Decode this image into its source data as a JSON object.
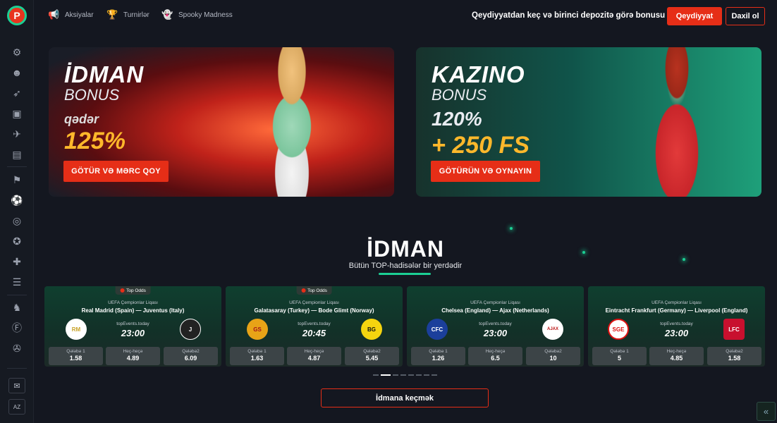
{
  "logo": "P",
  "sidebar": {
    "icons": [
      "gear-icon",
      "live-person-icon",
      "rocket-icon",
      "tv-icon",
      "aviator-icon",
      "casino-icon",
      "sports-icon",
      "football-icon",
      "roulette-icon",
      "wheel-icon",
      "gamepad-icon",
      "news-icon",
      "horse-icon",
      "fantasy-icon",
      "support-icon"
    ],
    "chat_label": "chat",
    "language_label": "AZ"
  },
  "topnav": {
    "items": [
      {
        "label": "Aksiyalar",
        "icon": "megaphone-icon"
      },
      {
        "label": "Turnirlər",
        "icon": "trophy-icon"
      },
      {
        "label": "Spooky Madness",
        "icon": "ghost-icon"
      }
    ],
    "promo": "Qeydiyyatdan keç və birinci depozitə görə bonusu götür",
    "register": "Qeydiyyat",
    "login": "Daxil ol"
  },
  "banners": [
    {
      "title": "İDMAN",
      "subtitle": "BONUS",
      "small": "qədər",
      "big": "125%",
      "button": "GÖTÜR VƏ MƏRC QOY"
    },
    {
      "title": "KAZINO",
      "subtitle": "BONUS",
      "mid": "120%",
      "big": "+ 250 FS",
      "button": "GÖTÜRÜN VƏ OYNAYIN"
    }
  ],
  "section": {
    "title": "İDMAN",
    "subtitle": "Bütün TOP-hadisələr bir yerdədir",
    "cta": "İdmana keçmək"
  },
  "events": [
    {
      "badge": "Top Odds",
      "league": "UEFA Çempionlar Liqası",
      "teams": "Real Madrid (Spain)  —  Juventus (Italy)",
      "site": "topEvents.today",
      "time": "23:00",
      "home": "RM",
      "away": "J",
      "odds": [
        {
          "label": "Qələbə 1",
          "value": "1.58"
        },
        {
          "label": "Heç-heçə",
          "value": "4.89"
        },
        {
          "label": "Qələbə2",
          "value": "6.09"
        }
      ]
    },
    {
      "badge": "Top Odds",
      "league": "UEFA Çempionlar Liqası",
      "teams": "Galatasaray (Turkey)  —  Bode Glimt (Norway)",
      "site": "topEvents.today",
      "time": "20:45",
      "home": "GS",
      "away": "BG",
      "odds": [
        {
          "label": "Qələbə 1",
          "value": "1.63"
        },
        {
          "label": "Heç-heçə",
          "value": "4.87"
        },
        {
          "label": "Qələbə2",
          "value": "5.45"
        }
      ]
    },
    {
      "badge": "",
      "league": "UEFA Çempionlar Liqası",
      "teams": "Chelsea (England)  —  Ajax (Netherlands)",
      "site": "topEvents.today",
      "time": "23:00",
      "home": "CFC",
      "away": "AJAX",
      "odds": [
        {
          "label": "Qələbə 1",
          "value": "1.26"
        },
        {
          "label": "Heç-heçə",
          "value": "6.5"
        },
        {
          "label": "Qələbə2",
          "value": "10"
        }
      ]
    },
    {
      "badge": "",
      "league": "UEFA Çempionlar Liqası",
      "teams": "Eintracht Frankfurt (Germany)  —  Liverpool (England)",
      "site": "topEvents.today",
      "time": "23:00",
      "home": "SGE",
      "away": "LFC",
      "odds": [
        {
          "label": "Qələbə 1",
          "value": "5"
        },
        {
          "label": "Heç-heçə",
          "value": "4.85"
        },
        {
          "label": "Qələbə2",
          "value": "1.58"
        }
      ]
    }
  ],
  "colors": {
    "accent": "#e62e17",
    "green": "#1ccf94",
    "bg": "#141720"
  }
}
